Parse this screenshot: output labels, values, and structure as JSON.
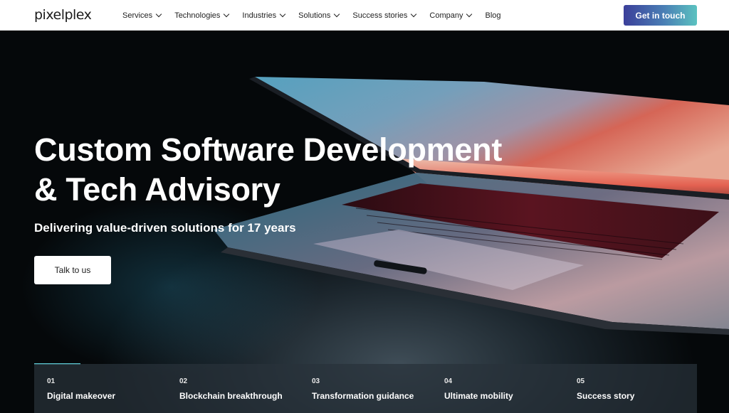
{
  "header": {
    "logo": "pixelplex",
    "nav": [
      {
        "label": "Services",
        "dropdown": true
      },
      {
        "label": "Technologies",
        "dropdown": true
      },
      {
        "label": "Industries",
        "dropdown": true
      },
      {
        "label": "Solutions",
        "dropdown": true
      },
      {
        "label": "Success stories",
        "dropdown": true
      },
      {
        "label": "Company",
        "dropdown": true
      },
      {
        "label": "Blog",
        "dropdown": false
      }
    ],
    "cta_label": "Get in touch"
  },
  "hero": {
    "title_line1": "Custom Software Development",
    "title_line2": "& Tech Advisory",
    "subtitle": "Delivering value-driven solutions for 17 years",
    "button_label": "Talk to us"
  },
  "tabs": [
    {
      "number": "01",
      "label": "Digital makeover"
    },
    {
      "number": "02",
      "label": "Blockchain breakthrough"
    },
    {
      "number": "03",
      "label": "Transformation guidance"
    },
    {
      "number": "04",
      "label": "Ultimate mobility"
    },
    {
      "number": "05",
      "label": "Success story"
    }
  ],
  "colors": {
    "accent_gradient_start": "#3b3f9a",
    "accent_gradient_end": "#5bc2c0",
    "tab_accent": "#5bc6d0"
  }
}
